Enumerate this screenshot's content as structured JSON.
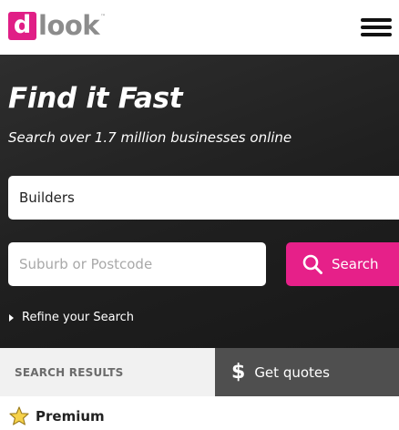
{
  "header": {
    "logo_letter": "d",
    "logo_text": "look",
    "logo_tm": "™",
    "menu_icon": "hamburger-menu-icon"
  },
  "hero": {
    "title": "Find it Fast",
    "subtitle": "Search over 1.7 million businesses online",
    "what_value": "Builders",
    "where_placeholder": "Suburb or Postcode",
    "search_label": "Search",
    "search_icon": "search-icon",
    "refine_label": "Refine your Search"
  },
  "tabs": {
    "results_label": "SEARCH RESULTS",
    "quotes_label": "Get quotes",
    "quotes_icon": "dollar-icon"
  },
  "listing": {
    "premium_label": "Premium",
    "premium_icon": "star-icon"
  },
  "colors": {
    "brand_pink": "#e62089",
    "logo_grey": "#8c8c8c",
    "hero_bg": "#222222",
    "quotes_tab_bg": "#4f4f4f",
    "results_tab_bg": "#f1f1f1",
    "star_fill": "#f6d24a"
  }
}
